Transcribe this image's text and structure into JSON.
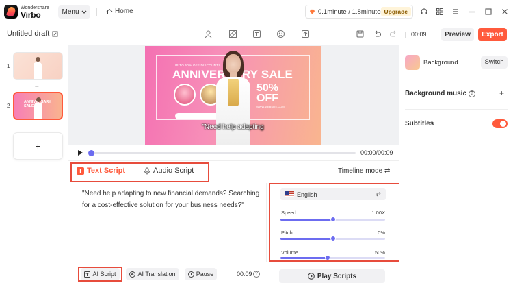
{
  "app": {
    "brand_top": "Wondershare",
    "brand_name": "Virbo",
    "menu_label": "Menu",
    "home_label": "Home",
    "credits": "0.1minute / 1.8minutes",
    "upgrade_label": "Upgrade"
  },
  "toolbar": {
    "draft_title": "Untitled draft",
    "duration": "00:09",
    "preview_label": "Preview",
    "export_label": "Export"
  },
  "slides": {
    "items": [
      {
        "number": "1"
      },
      {
        "number": "2",
        "label": "ANNIVERSARY SALE"
      }
    ],
    "add_label": "+"
  },
  "stage": {
    "small_text": "UP TO 50% OFF DISCOUNTS",
    "title": "ANNIVERSARY SALE",
    "percent": "50%",
    "off": "OFF",
    "url": "WWW.WEBSITE.COM",
    "caption": "\"Need help adapting"
  },
  "timeline": {
    "time": "00:00/00:09",
    "progress_fraction": 0.0
  },
  "script": {
    "tab_text": "Text Script",
    "tab_audio": "Audio Script",
    "timeline_mode": "Timeline mode",
    "content": "\"Need help adapting to new financial demands? Searching for a cost-effective solution for your business needs?\"",
    "ai_script_label": "AI Script",
    "ai_translation_label": "AI Translation",
    "pause_label": "Pause",
    "duration": "00:09"
  },
  "voice": {
    "language": "English",
    "speed_label": "Speed",
    "speed_value": "1.00X",
    "speed_fraction": 0.5,
    "pitch_label": "Pitch",
    "pitch_value": "0%",
    "pitch_fraction": 0.5,
    "volume_label": "Volume",
    "volume_value": "50%",
    "volume_fraction": 0.45,
    "play_label": "Play Scripts"
  },
  "right_panel": {
    "background_label": "Background",
    "switch_label": "Switch",
    "music_label": "Background music",
    "subtitles_label": "Subtitles",
    "subtitles_on": true
  },
  "colors": {
    "accent": "#ff5a3c",
    "slider": "#6c6cf0"
  }
}
